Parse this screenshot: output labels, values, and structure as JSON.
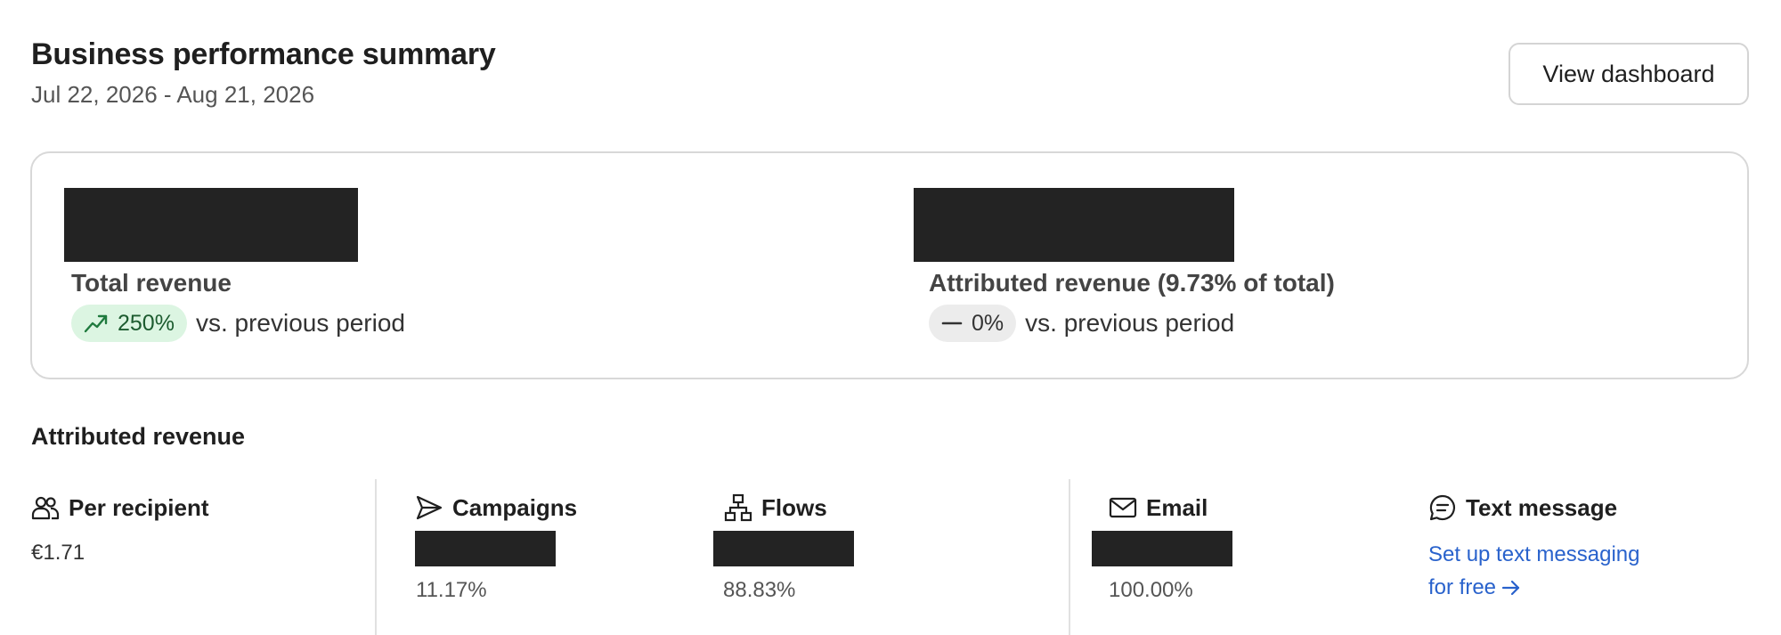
{
  "header": {
    "title": "Business performance summary",
    "date_range": "Jul 22, 2026 - Aug 21, 2026",
    "view_dashboard_label": "View dashboard"
  },
  "summary": {
    "total_revenue": {
      "label": "Total revenue",
      "delta": "250%",
      "delta_icon": "trending-up-icon",
      "comparison": "vs. previous period"
    },
    "attributed_revenue": {
      "label": "Attributed revenue (9.73% of total)",
      "delta": "0%",
      "delta_icon": "minus-icon",
      "comparison": "vs. previous period"
    }
  },
  "attributed_section": {
    "title": "Attributed revenue",
    "per_recipient": {
      "label": "Per recipient",
      "icon": "people-icon",
      "value": "€1.71"
    },
    "campaigns": {
      "label": "Campaigns",
      "icon": "send-icon",
      "pct": "11.17%"
    },
    "flows": {
      "label": "Flows",
      "icon": "flow-icon",
      "pct": "88.83%"
    },
    "email": {
      "label": "Email",
      "icon": "mail-icon",
      "pct": "100.00%"
    },
    "text_message": {
      "label": "Text message",
      "icon": "chat-icon",
      "cta_line1": "Set up text messaging",
      "cta_line2": "for free"
    }
  },
  "colors": {
    "accent_link": "#2962cc",
    "positive_pill_bg": "#dcf5e2",
    "neutral_pill_bg": "#ececec",
    "redaction": "#232323"
  }
}
